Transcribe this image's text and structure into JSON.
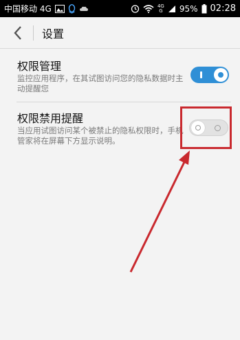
{
  "status_bar": {
    "carrier": "中国移动 4G",
    "network_top": "4G",
    "network_bottom": "G",
    "battery": "95%",
    "time": "02:28"
  },
  "header": {
    "title": "设置",
    "back_icon": "chevron-left-icon"
  },
  "settings": [
    {
      "title": "权限管理",
      "subtitle": "监控应用程序，在其试图访问您的隐私数据时主动提醒您",
      "enabled": true
    },
    {
      "title": "权限禁用提醒",
      "subtitle": "当应用试图访问某个被禁止的隐私权限时，手机管家将在屏幕下方显示说明。",
      "enabled": false
    }
  ],
  "colors": {
    "accent": "#2f8fd6",
    "annotation": "#c9292e"
  }
}
